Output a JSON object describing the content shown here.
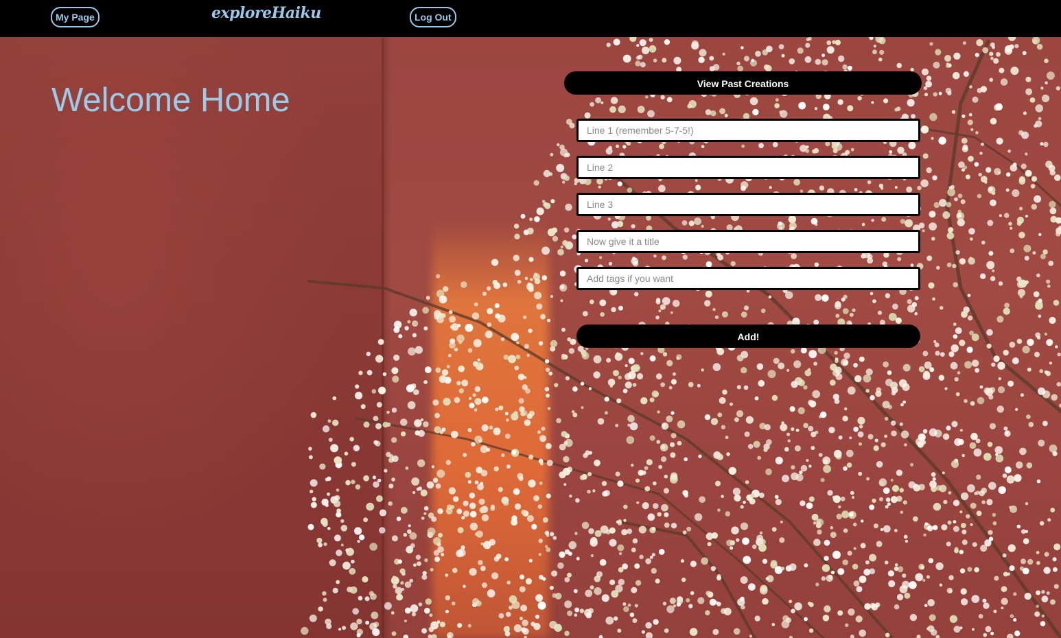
{
  "nav": {
    "my_page_label": "My Page",
    "brand": "exploreHaiku",
    "log_out_label": "Log Out"
  },
  "main": {
    "heading": "Welcome Home",
    "view_past_label": "View Past Creations",
    "form": {
      "line1_placeholder": "Line 1 (remember 5-7-5!)",
      "line2_placeholder": "Line 2",
      "line3_placeholder": "Line 3",
      "title_placeholder": "Now give it a title",
      "tags_placeholder": "Add tags if you want",
      "submit_label": "Add!"
    }
  },
  "colors": {
    "accent": "#9ac8e8",
    "topbar": "#000000",
    "wall": "#94413b",
    "button": "#000000"
  }
}
